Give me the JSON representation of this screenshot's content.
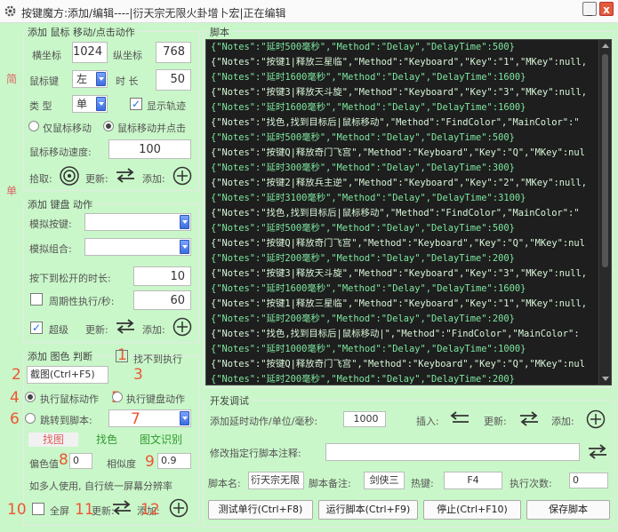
{
  "window": {
    "title": "按键魔方:添加/编辑----|衍天宗无限火卦增卜宏|正在编辑",
    "min_label": "_",
    "close_label": "x"
  },
  "side_tabs": [
    "简",
    "单"
  ],
  "mouse_group": {
    "legend": "添加 鼠标 移动/点击动作",
    "x_label": "横坐标",
    "x_value": "1024",
    "y_label": "纵坐标",
    "y_value": "768",
    "key_label": "鼠标键",
    "key_value": "左",
    "duration_label": "时 长",
    "duration_value": "50",
    "type_label": "类 型",
    "type_value": "单",
    "show_track_label": "显示轨迹",
    "move_only_label": "仅鼠标移动",
    "move_click_label": "鼠标移动并点击",
    "speed_label": "鼠标移动速度:",
    "speed_value": "100",
    "pick_label": "拾取:",
    "update_label": "更新:",
    "add_label": "添加:"
  },
  "keyboard_group": {
    "legend": "添加 键盘 动作",
    "sim_key_label": "模拟按键:",
    "sim_combo_label": "模拟组合:",
    "hold_label": "按下到松开的时长:",
    "hold_value": "10",
    "periodic_label": "周期性执行/秒:",
    "periodic_value": "60",
    "super_label": "超级",
    "update_label": "更新:",
    "add_label": "添加:"
  },
  "image_group": {
    "legend": "添加 图色 判断",
    "not_found_label": "找不到执行",
    "screenshot_button": "截图(Ctrl+F5)",
    "exec_mouse_label": "执行鼠标动作",
    "exec_key_label": "执行键盘动作",
    "jump_label": "跳转到脚本:",
    "tabs": [
      "找图",
      "找色",
      "图文识别"
    ],
    "offset_label": "偏色值",
    "offset_value": "0",
    "similarity_label": "相似度",
    "similarity_value": "0.9",
    "note": "如多人使用, 自行统一屏幕分辨率",
    "fullscreen_label": "全屏",
    "update_label": "更新:",
    "add_label": "添加:",
    "markers": [
      "1",
      "2",
      "3",
      "4",
      "5",
      "6",
      "7",
      "8",
      "9",
      "10",
      "11",
      "12"
    ]
  },
  "script_panel": {
    "legend": "脚本",
    "lines": [
      "{\"Notes\":\"延时500毫秒\",\"Method\":\"Delay\",\"DelayTime\":500}",
      "{\"Notes\":\"按键1|释放三星临\",\"Method\":\"Keyboard\",\"Key\":\"1\",\"MKey\":null,",
      "{\"Notes\":\"延时1600毫秒\",\"Method\":\"Delay\",\"DelayTime\":1600}",
      "{\"Notes\":\"按键3|释放天斗旋\",\"Method\":\"Keyboard\",\"Key\":\"3\",\"MKey\":null,",
      "{\"Notes\":\"延时1600毫秒\",\"Method\":\"Delay\",\"DelayTime\":1600}",
      "{\"Notes\":\"找色,找到目标后|鼠标移动\",\"Method\":\"FindColor\",\"MainColor\":\"",
      "{\"Notes\":\"延时500毫秒\",\"Method\":\"Delay\",\"DelayTime\":500}",
      "{\"Notes\":\"按键Q|释放奇门飞宫\",\"Method\":\"Keyboard\",\"Key\":\"Q\",\"MKey\":nul",
      "{\"Notes\":\"延时300毫秒\",\"Method\":\"Delay\",\"DelayTime\":300}",
      "{\"Notes\":\"按键2|释放兵主逆\",\"Method\":\"Keyboard\",\"Key\":\"2\",\"MKey\":null,",
      "{\"Notes\":\"延时3100毫秒\",\"Method\":\"Delay\",\"DelayTime\":3100}",
      "{\"Notes\":\"找色,找到目标后|鼠标移动\",\"Method\":\"FindColor\",\"MainColor\":\"",
      "{\"Notes\":\"延时500毫秒\",\"Method\":\"Delay\",\"DelayTime\":500}",
      "{\"Notes\":\"按键Q|释放奇门飞宫\",\"Method\":\"Keyboard\",\"Key\":\"Q\",\"MKey\":nul",
      "{\"Notes\":\"延时200毫秒\",\"Method\":\"Delay\",\"DelayTime\":200}",
      "{\"Notes\":\"按键3|释放天斗旋\",\"Method\":\"Keyboard\",\"Key\":\"3\",\"MKey\":null,",
      "{\"Notes\":\"延时1600毫秒\",\"Method\":\"Delay\",\"DelayTime\":1600}",
      "{\"Notes\":\"按键1|释放三星临\",\"Method\":\"Keyboard\",\"Key\":\"1\",\"MKey\":null,",
      "{\"Notes\":\"延时200毫秒\",\"Method\":\"Delay\",\"DelayTime\":200}",
      "{\"Notes\":\"找色,找到目标后|鼠标移动|\",\"Method\":\"FindColor\",\"MainColor\":",
      "{\"Notes\":\"延时1000毫秒\",\"Method\":\"Delay\",\"DelayTime\":1000}",
      "{\"Notes\":\"按键Q|释放奇门飞宫\",\"Method\":\"Keyboard\",\"Key\":\"Q\",\"MKey\":nul",
      "{\"Notes\":\"延时200毫秒\",\"Method\":\"Delay\",\"DelayTime\":200}"
    ]
  },
  "dev_group": {
    "legend": "开发调试",
    "delay_label": "添加延时动作/单位/毫秒:",
    "delay_value": "1000",
    "insert_label": "插入:",
    "update_label": "更新:",
    "add_label": "添加:",
    "comment_label": "修改指定行脚本注释:",
    "name_label": "脚本名:",
    "name_value": "衍天宗无限",
    "remark_label": "脚本备注:",
    "remark_value": "剑侠三",
    "hotkey_label": "热键:",
    "hotkey_value": "F4",
    "count_label": "执行次数:",
    "count_value": "0",
    "test_button": "测试单行(Ctrl+F8)",
    "run_button": "运行脚本(Ctrl+F9)",
    "stop_button": "停止(Ctrl+F10)",
    "save_button": "保存脚本"
  }
}
